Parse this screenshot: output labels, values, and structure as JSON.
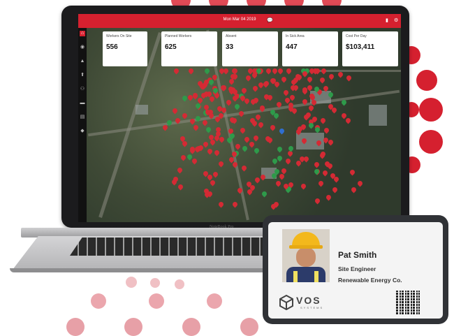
{
  "app": {
    "date_label": "Mon Mar 04 2019",
    "accent_color": "#d5202f"
  },
  "sidebar": {
    "icons": [
      "home-icon",
      "dashboard-icon",
      "alert-icon",
      "location-icon",
      "people-icon",
      "chat-icon",
      "document-icon",
      "settings-icon"
    ]
  },
  "stats": [
    {
      "label": "Workers On Site",
      "value": "556"
    },
    {
      "label": "Planned Workers",
      "value": "625"
    },
    {
      "label": "Absent",
      "value": "33"
    },
    {
      "label": "In Sick Area",
      "value": "447"
    },
    {
      "label": "Cost Per Day",
      "value": "$103,411"
    }
  ],
  "laptop": {
    "brand": "NoteBook Pro"
  },
  "badge": {
    "name": "Pat Smith",
    "role": "Site Engineer",
    "company": "Renewable Energy Co.",
    "logo_text": "VOS",
    "logo_subtext": "SYSTEMS"
  },
  "map_pins": {
    "colors": {
      "red": "#d42a34",
      "green": "#2e9a4a",
      "blue": "#2f6fd0"
    }
  }
}
